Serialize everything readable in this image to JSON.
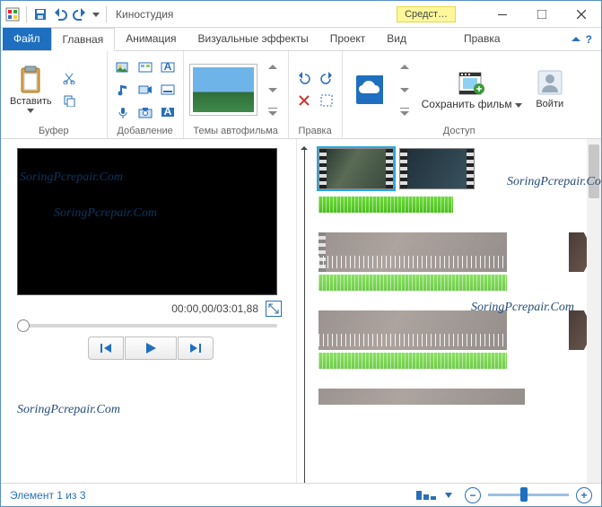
{
  "titlebar": {
    "app_title": "Киностудия",
    "context_tab": "Средст…"
  },
  "tabs": {
    "file": "Файл",
    "items": [
      "Главная",
      "Анимация",
      "Визуальные эффекты",
      "Проект",
      "Вид",
      "Правка"
    ],
    "active_index": 0
  },
  "ribbon": {
    "paste_label": "Вставить",
    "group_buffer": "Буфер",
    "group_add": "Добавление",
    "group_themes": "Темы автофильма",
    "group_edit": "Правка",
    "save_movie_label": "Сохранить фильм",
    "signin_label": "Войти",
    "group_access": "Доступ"
  },
  "player": {
    "timecode": "00:00,00/03:01,88"
  },
  "status": {
    "element_text": "Элемент 1 из 3"
  },
  "watermark": "SoringPcrepair.Com"
}
